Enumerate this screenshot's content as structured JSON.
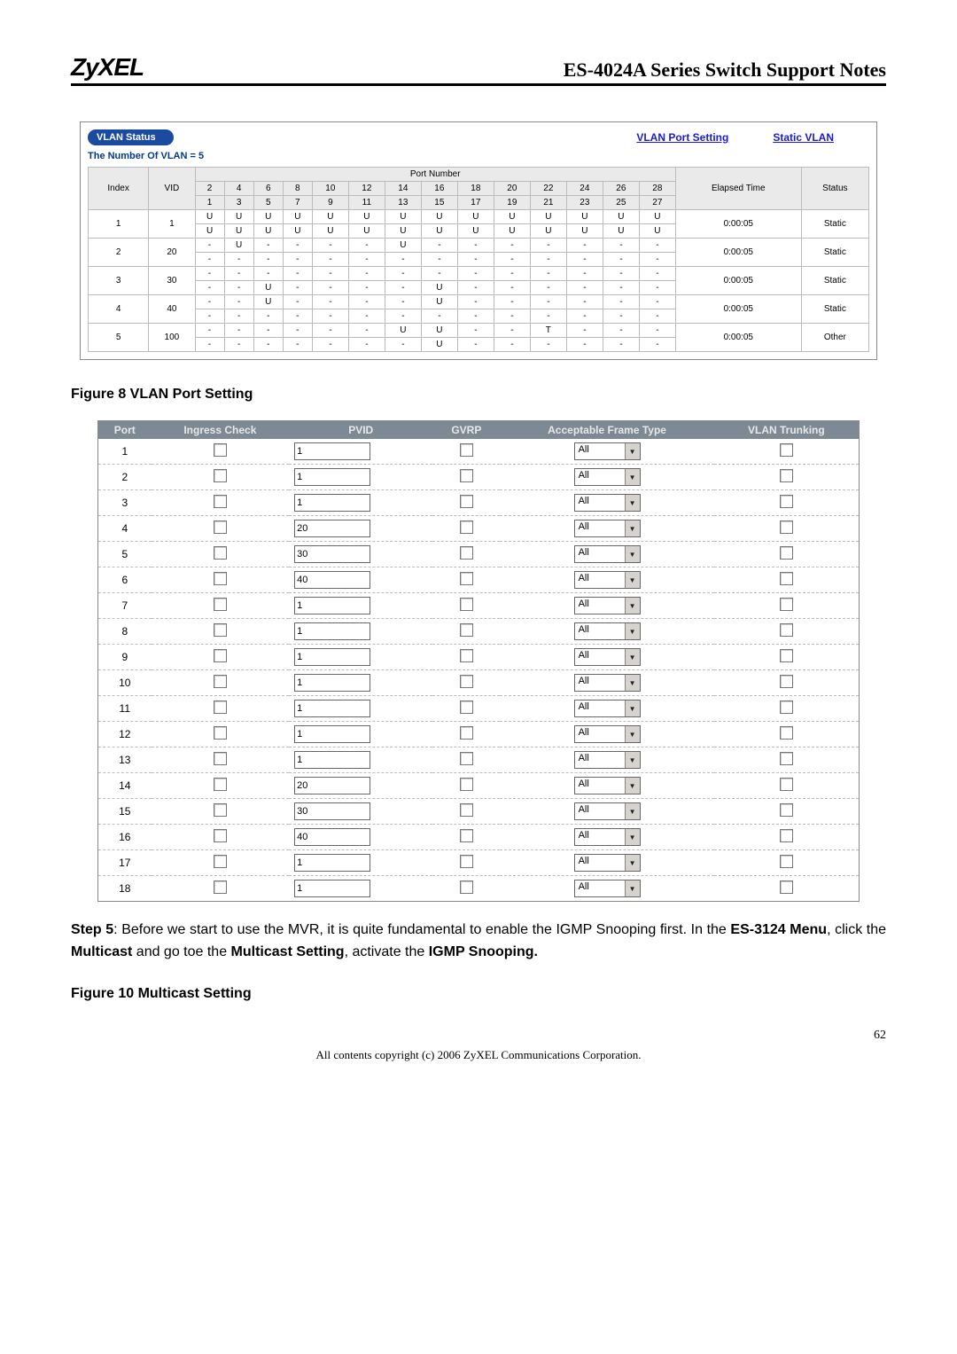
{
  "header": {
    "logo": "ZyXEL",
    "title": "ES-4024A Series Switch Support Notes"
  },
  "vlan_status": {
    "panel_title": "VLAN Status",
    "links": {
      "port_setting": "VLAN Port Setting",
      "static_vlan": "Static VLAN"
    },
    "count_label": "The Number Of VLAN = 5",
    "headers": {
      "index": "Index",
      "vid": "VID",
      "port_number": "Port Number",
      "elapsed": "Elapsed Time",
      "status": "Status"
    },
    "port_cols_top": [
      "2",
      "4",
      "6",
      "8",
      "10",
      "12",
      "14",
      "16",
      "18",
      "20",
      "22",
      "24",
      "26",
      "28"
    ],
    "port_cols_bottom": [
      "1",
      "3",
      "5",
      "7",
      "9",
      "11",
      "13",
      "15",
      "17",
      "19",
      "21",
      "23",
      "25",
      "27"
    ],
    "rows": [
      {
        "index": "1",
        "vid": "1",
        "top": [
          "U",
          "U",
          "U",
          "U",
          "U",
          "U",
          "U",
          "U",
          "U",
          "U",
          "U",
          "U",
          "U",
          "U"
        ],
        "bottom": [
          "U",
          "U",
          "U",
          "U",
          "U",
          "U",
          "U",
          "U",
          "U",
          "U",
          "U",
          "U",
          "U",
          "U"
        ],
        "elapsed": "0:00:05",
        "status": "Static"
      },
      {
        "index": "2",
        "vid": "20",
        "top": [
          "-",
          "U",
          "-",
          "-",
          "-",
          "-",
          "U",
          "-",
          "-",
          "-",
          "-",
          "-",
          "-",
          "-"
        ],
        "bottom": [
          "-",
          "-",
          "-",
          "-",
          "-",
          "-",
          "-",
          "-",
          "-",
          "-",
          "-",
          "-",
          "-",
          "-"
        ],
        "elapsed": "0:00:05",
        "status": "Static"
      },
      {
        "index": "3",
        "vid": "30",
        "top": [
          "-",
          "-",
          "-",
          "-",
          "-",
          "-",
          "-",
          "-",
          "-",
          "-",
          "-",
          "-",
          "-",
          "-"
        ],
        "bottom": [
          "-",
          "-",
          "U",
          "-",
          "-",
          "-",
          "-",
          "U",
          "-",
          "-",
          "-",
          "-",
          "-",
          "-"
        ],
        "elapsed": "0:00:05",
        "status": "Static"
      },
      {
        "index": "4",
        "vid": "40",
        "top": [
          "-",
          "-",
          "U",
          "-",
          "-",
          "-",
          "-",
          "U",
          "-",
          "-",
          "-",
          "-",
          "-",
          "-"
        ],
        "bottom": [
          "-",
          "-",
          "-",
          "-",
          "-",
          "-",
          "-",
          "-",
          "-",
          "-",
          "-",
          "-",
          "-",
          "-"
        ],
        "elapsed": "0:00:05",
        "status": "Static"
      },
      {
        "index": "5",
        "vid": "100",
        "top": [
          "-",
          "-",
          "-",
          "-",
          "-",
          "-",
          "U",
          "U",
          "-",
          "-",
          "T",
          "-",
          "-",
          "-"
        ],
        "bottom": [
          "-",
          "-",
          "-",
          "-",
          "-",
          "-",
          "-",
          "U",
          "-",
          "-",
          "-",
          "-",
          "-",
          "-"
        ],
        "elapsed": "0:00:05",
        "status": "Other"
      }
    ]
  },
  "figure8": "Figure 8 VLAN Port Setting",
  "port_table": {
    "headers": {
      "port": "Port",
      "ingress": "Ingress Check",
      "pvid": "PVID",
      "gvrp": "GVRP",
      "frame_type": "Acceptable Frame Type",
      "trunking": "VLAN Trunking"
    },
    "frame_option": "All",
    "rows": [
      {
        "port": "1",
        "pvid": "1"
      },
      {
        "port": "2",
        "pvid": "1"
      },
      {
        "port": "3",
        "pvid": "1"
      },
      {
        "port": "4",
        "pvid": "20"
      },
      {
        "port": "5",
        "pvid": "30"
      },
      {
        "port": "6",
        "pvid": "40"
      },
      {
        "port": "7",
        "pvid": "1"
      },
      {
        "port": "8",
        "pvid": "1"
      },
      {
        "port": "9",
        "pvid": "1"
      },
      {
        "port": "10",
        "pvid": "1"
      },
      {
        "port": "11",
        "pvid": "1"
      },
      {
        "port": "12",
        "pvid": "1"
      },
      {
        "port": "13",
        "pvid": "1"
      },
      {
        "port": "14",
        "pvid": "20"
      },
      {
        "port": "15",
        "pvid": "30"
      },
      {
        "port": "16",
        "pvid": "40"
      },
      {
        "port": "17",
        "pvid": "1"
      },
      {
        "port": "18",
        "pvid": "1"
      }
    ]
  },
  "step5": {
    "label": "Step 5",
    "t1": ": Before we start to use the MVR, it is quite fundamental to enable the IGMP Snooping first. In the ",
    "b1": "ES-3124 Menu",
    "t2": ", click the ",
    "b2": "Multicast",
    "t3": " and go toe the ",
    "b3": "Multicast Setting",
    "t4": ", activate the ",
    "b4": "IGMP Snooping.",
    "t5": ""
  },
  "figure10": "Figure 10 Multicast Setting",
  "page_num": "62",
  "footer": "All contents copyright (c) 2006 ZyXEL Communications Corporation."
}
